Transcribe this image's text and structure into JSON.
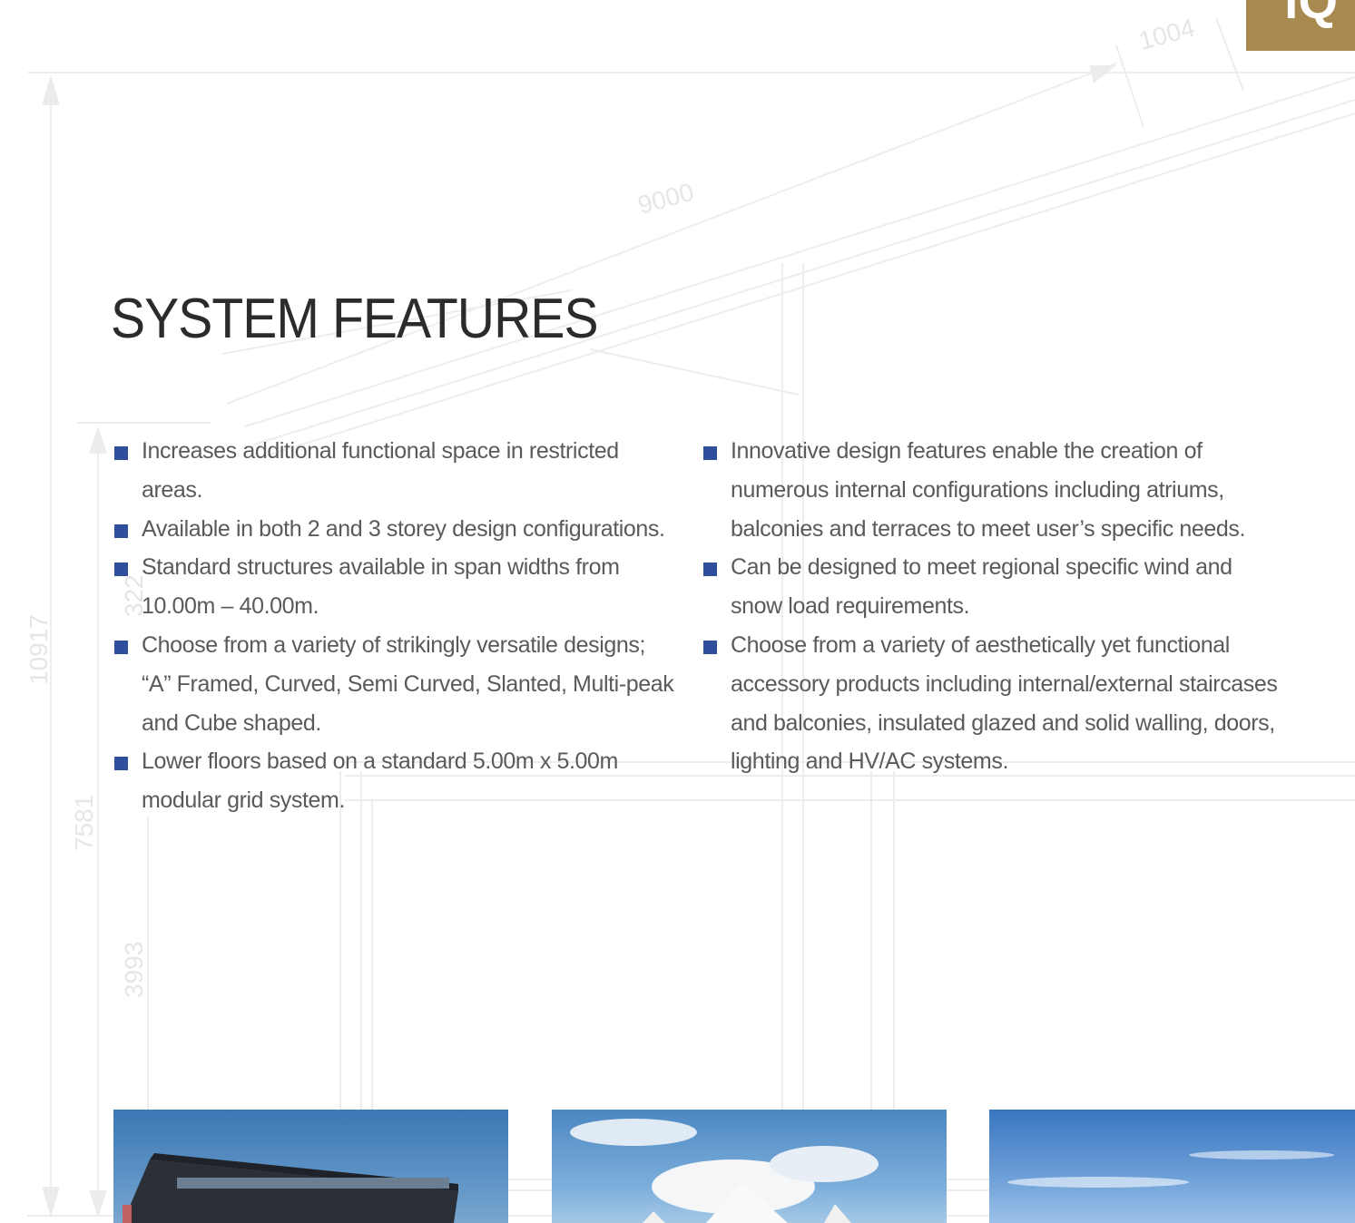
{
  "corner_tab": {
    "glyph": "iQ",
    "color": "#a8894f"
  },
  "blueprint": {
    "dimensions": [
      "1004",
      "9000",
      "10917",
      "7581",
      "3993",
      "322"
    ],
    "line_color": "#ececec"
  },
  "title": "SYSTEM FEATURES",
  "bullet_color": "#2f4f9c",
  "features_left": [
    "Increases additional functional space in restricted areas.",
    "Available in both 2 and 3 storey design configurations.",
    "Standard structures available in span widths from 10.00m – 40.00m.",
    "Choose from a variety of strikingly versatile designs; “A” Framed, Curved, Semi Curved, Slanted, Multi-peak and Cube shaped.",
    "Lower floors based on a standard 5.00m x 5.00m modular grid system."
  ],
  "features_right": [
    "Innovative design features enable the creation of numerous internal configurations including atriums, balconies and terraces to meet user’s specific needs.",
    "Can be designed to meet regional specific wind and snow load requirements.",
    "Choose from a variety of aesthetically yet functional accessory products including internal/external staircases and balconies, insulated glazed and solid walling, doors, lighting and HV/AC systems."
  ],
  "photos": [
    {
      "subject": "two-storey-glazed-structure-photo"
    },
    {
      "subject": "multi-peak-tent-photo"
    },
    {
      "subject": "sky-photo"
    }
  ]
}
